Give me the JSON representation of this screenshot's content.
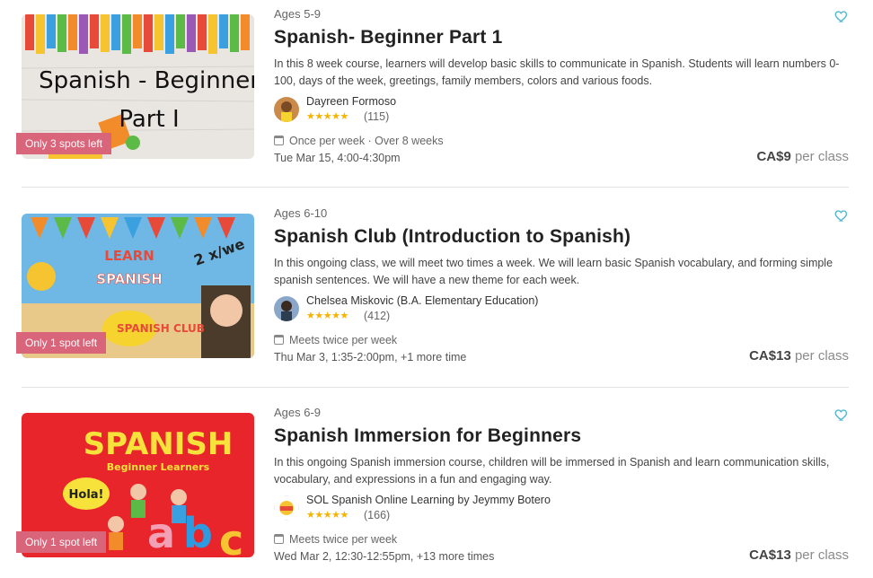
{
  "courses": [
    {
      "ages": "Ages 5-9",
      "title": "Spanish- Beginner Part 1",
      "description": "In this 8 week course, learners will develop basic skills to communicate in Spanish. Students will learn numbers 0-100, days of the week, greetings, family members, colors and various foods.",
      "teacher": "Dayreen Formoso",
      "rating_stars": "★★★★★",
      "reviews": "(115)",
      "schedule": "Once per week · Over 8 weeks",
      "next_time": "Tue Mar 15, 4:00-4:30pm",
      "price": "CA$9",
      "per": "per class",
      "spots": "Only 3 spots left",
      "thumb_text_1": "Spanish - Beginner",
      "thumb_text_2": "Part I"
    },
    {
      "ages": "Ages 6-10",
      "title": "Spanish Club (Introduction to Spanish)",
      "description": "In this ongoing class, we will meet two times a week. We will learn basic Spanish vocabulary, and forming simple spanish sentences. We will have a new theme for each week.",
      "teacher": "Chelsea Miskovic (B.A. Elementary Education)",
      "rating_stars": "★★★★★",
      "reviews": "(412)",
      "schedule": "Meets twice per week",
      "next_time": "Thu Mar 3, 1:35-2:00pm, +1 more time",
      "price": "CA$13",
      "per": "per class",
      "spots": "Only 1 spot left",
      "thumb_text_1": "LEARN",
      "thumb_text_2": "SPANISH",
      "thumb_text_3": "SPANISH CLUB",
      "thumb_text_4": "2 x/we"
    },
    {
      "ages": "Ages 6-9",
      "title": "Spanish Immersion for Beginners",
      "description": "In this ongoing Spanish immersion course, children will be immersed in Spanish and learn communication skills, vocabulary, and expressions in a fun and engaging way.",
      "teacher": "SOL Spanish Online Learning by Jeymmy Botero",
      "rating_stars": "★★★★★",
      "reviews": "(166)",
      "schedule": "Meets twice per week",
      "next_time": "Wed Mar 2, 12:30-12:55pm, +13 more times",
      "price": "CA$13",
      "per": "per class",
      "spots": "Only 1 spot left",
      "thumb_text_1": "SPANISH",
      "thumb_text_2": "Beginner Learners",
      "thumb_text_3": "Hola!"
    }
  ],
  "colors": {
    "spots_badge": "#d9657a",
    "star": "#f5b400",
    "heart": "#4db6d3"
  }
}
